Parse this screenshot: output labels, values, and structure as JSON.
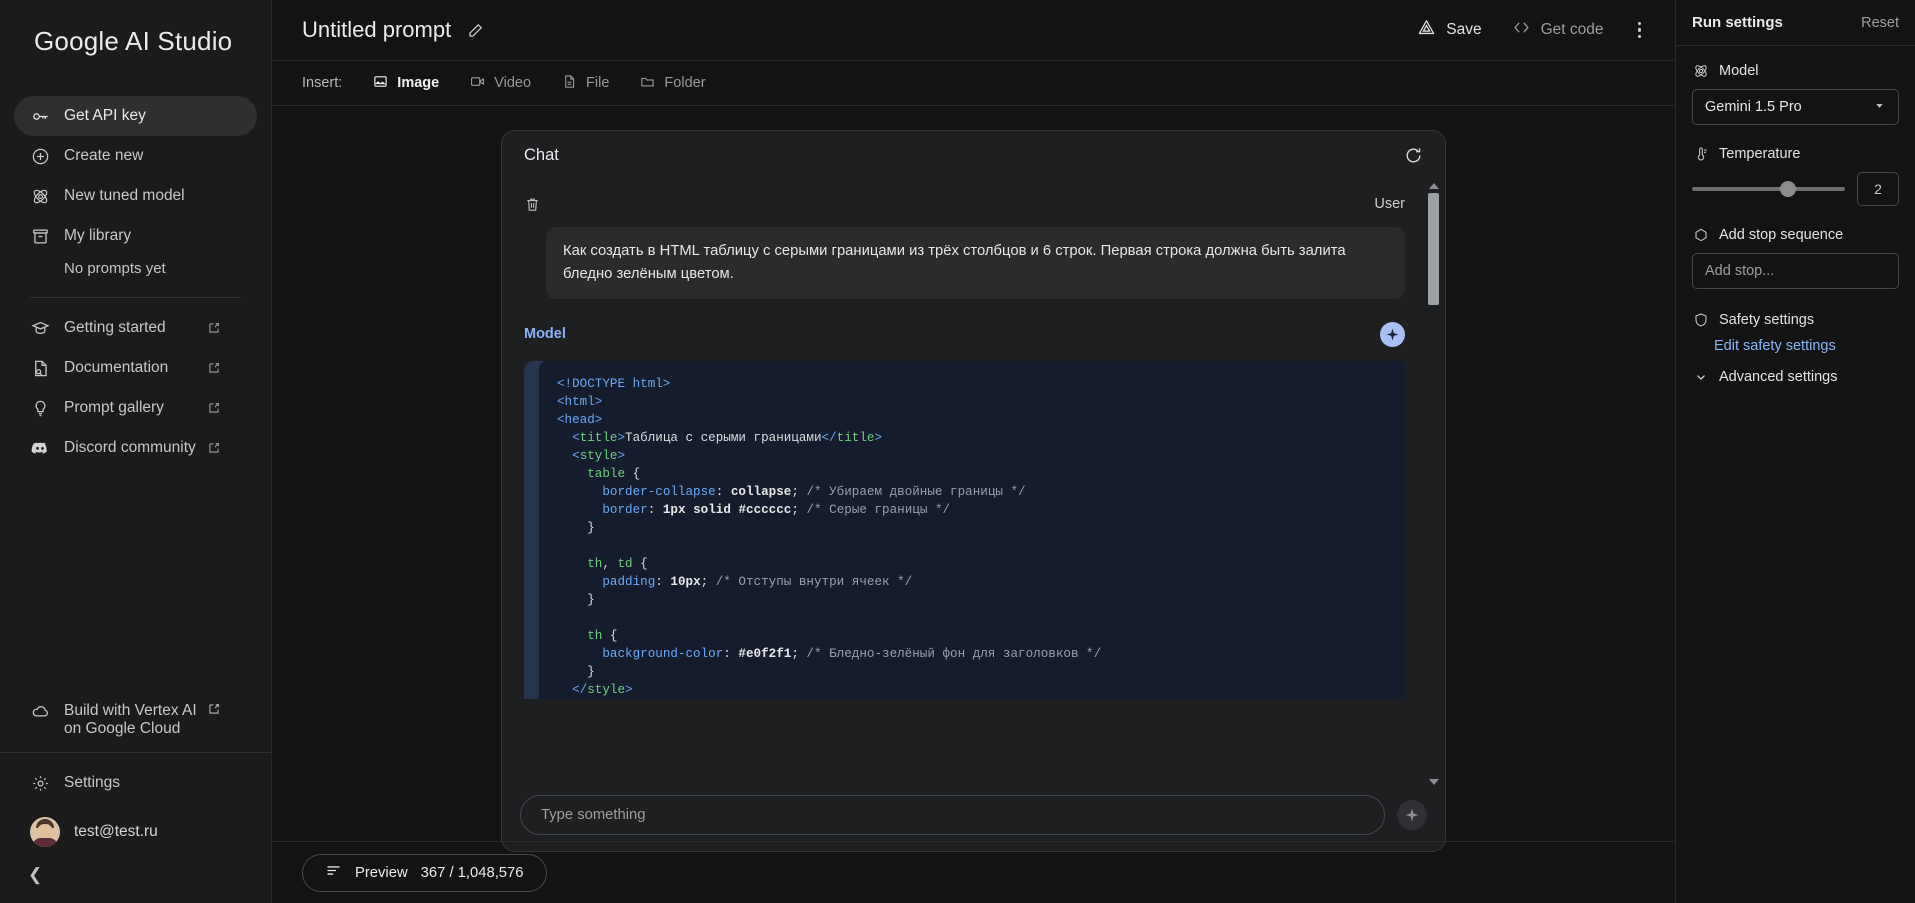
{
  "sidebar": {
    "brand": "Google AI Studio",
    "items": [
      {
        "label": "Get API key",
        "icon": "key-icon",
        "active": true,
        "external": false
      },
      {
        "label": "Create new",
        "icon": "plus-circle-icon",
        "active": false,
        "external": false
      },
      {
        "label": "New tuned model",
        "icon": "tuned-model-icon",
        "active": false,
        "external": false
      },
      {
        "label": "My library",
        "icon": "library-icon",
        "active": false,
        "external": false
      }
    ],
    "empty_note": "No prompts yet",
    "links": [
      {
        "label": "Getting started",
        "icon": "graduation-cap-icon",
        "external": true
      },
      {
        "label": "Documentation",
        "icon": "document-search-icon",
        "external": true
      },
      {
        "label": "Prompt gallery",
        "icon": "lightbulb-icon",
        "external": true
      },
      {
        "label": "Discord community",
        "icon": "discord-icon",
        "external": true
      }
    ],
    "vertex": {
      "label": "Build with Vertex AI on Google Cloud",
      "icon": "cloud-icon"
    },
    "settings": {
      "label": "Settings",
      "icon": "gear-icon"
    },
    "account": {
      "email": "test@test.ru"
    }
  },
  "header": {
    "prompt_title": "Untitled prompt",
    "edit_icon": "pencil-icon",
    "save_label": "Save",
    "save_icon": "save-drive-icon",
    "get_code_label": "Get code",
    "get_code_icon": "code-brackets-icon",
    "more_icon": "kebab-menu-icon"
  },
  "insert_bar": {
    "label": "Insert:",
    "items": [
      {
        "label": "Image",
        "icon": "image-icon",
        "selected": true
      },
      {
        "label": "Video",
        "icon": "video-icon",
        "selected": false
      },
      {
        "label": "File",
        "icon": "file-icon",
        "selected": false
      },
      {
        "label": "Folder",
        "icon": "folder-icon",
        "selected": false
      }
    ]
  },
  "chat": {
    "title": "Chat",
    "refresh_icon": "refresh-icon",
    "user_turn": {
      "role": "User",
      "delete_icon": "trash-icon",
      "text": "Как создать в HTML таблицу с серыми границами из трёх столбцов и 6 строк. Первая строка должна быть залита бледно зелёным цветом."
    },
    "model_turn": {
      "role": "Model",
      "sparkle_icon": "sparkle-icon",
      "code_lines": [
        [
          {
            "t": "tag",
            "s": "<!DOCTYPE html>"
          }
        ],
        [
          {
            "t": "tag",
            "s": "<html>"
          }
        ],
        [
          {
            "t": "tag",
            "s": "<head>"
          }
        ],
        [
          {
            "t": "plain",
            "s": "  "
          },
          {
            "t": "tag",
            "s": "<"
          },
          {
            "t": "tagname",
            "s": "title"
          },
          {
            "t": "tag",
            "s": ">"
          },
          {
            "t": "plain",
            "s": "Таблица с серыми границами"
          },
          {
            "t": "tag",
            "s": "</"
          },
          {
            "t": "tagname",
            "s": "title"
          },
          {
            "t": "tag",
            "s": ">"
          }
        ],
        [
          {
            "t": "plain",
            "s": "  "
          },
          {
            "t": "tag",
            "s": "<"
          },
          {
            "t": "tagname",
            "s": "style"
          },
          {
            "t": "tag",
            "s": ">"
          }
        ],
        [
          {
            "t": "plain",
            "s": "    "
          },
          {
            "t": "sel",
            "s": "table"
          },
          {
            "t": "punc",
            "s": " {"
          }
        ],
        [
          {
            "t": "plain",
            "s": "      "
          },
          {
            "t": "prop",
            "s": "border-collapse"
          },
          {
            "t": "punc",
            "s": ": "
          },
          {
            "t": "val",
            "s": "collapse"
          },
          {
            "t": "punc",
            "s": ";"
          },
          {
            "t": "cmt",
            "s": " /* Убираем двойные границы */"
          }
        ],
        [
          {
            "t": "plain",
            "s": "      "
          },
          {
            "t": "prop",
            "s": "border"
          },
          {
            "t": "punc",
            "s": ": "
          },
          {
            "t": "num",
            "s": "1px"
          },
          {
            "t": "punc",
            "s": " "
          },
          {
            "t": "val",
            "s": "solid"
          },
          {
            "t": "punc",
            "s": " "
          },
          {
            "t": "num",
            "s": "#cccccc"
          },
          {
            "t": "punc",
            "s": ";"
          },
          {
            "t": "cmt",
            "s": " /* Серые границы */"
          }
        ],
        [
          {
            "t": "plain",
            "s": "    "
          },
          {
            "t": "punc",
            "s": "}"
          }
        ],
        [
          {
            "t": "plain",
            "s": ""
          }
        ],
        [
          {
            "t": "plain",
            "s": "    "
          },
          {
            "t": "sel",
            "s": "th"
          },
          {
            "t": "punc",
            "s": ", "
          },
          {
            "t": "sel",
            "s": "td"
          },
          {
            "t": "punc",
            "s": " {"
          }
        ],
        [
          {
            "t": "plain",
            "s": "      "
          },
          {
            "t": "prop",
            "s": "padding"
          },
          {
            "t": "punc",
            "s": ": "
          },
          {
            "t": "num",
            "s": "10px"
          },
          {
            "t": "punc",
            "s": ";"
          },
          {
            "t": "cmt",
            "s": " /* Отступы внутри ячеек */"
          }
        ],
        [
          {
            "t": "plain",
            "s": "    "
          },
          {
            "t": "punc",
            "s": "}"
          }
        ],
        [
          {
            "t": "plain",
            "s": ""
          }
        ],
        [
          {
            "t": "plain",
            "s": "    "
          },
          {
            "t": "sel",
            "s": "th"
          },
          {
            "t": "punc",
            "s": " {"
          }
        ],
        [
          {
            "t": "plain",
            "s": "      "
          },
          {
            "t": "prop",
            "s": "background-color"
          },
          {
            "t": "punc",
            "s": ": "
          },
          {
            "t": "num",
            "s": "#e0f2f1"
          },
          {
            "t": "punc",
            "s": ";"
          },
          {
            "t": "cmt",
            "s": " /* Бледно-зелёный фон для заголовков */"
          }
        ],
        [
          {
            "t": "plain",
            "s": "    "
          },
          {
            "t": "punc",
            "s": "}"
          }
        ],
        [
          {
            "t": "plain",
            "s": "  "
          },
          {
            "t": "tag",
            "s": "</"
          },
          {
            "t": "tagname",
            "s": "style"
          },
          {
            "t": "tag",
            "s": ">"
          }
        ]
      ]
    },
    "input_placeholder": "Type something",
    "input_value": "",
    "send_icon": "sparkle-send-icon"
  },
  "bottom_bar": {
    "preview_label": "Preview",
    "preview_icon": "lines-icon",
    "token_count": "367 / 1,048,576"
  },
  "run_settings": {
    "title": "Run settings",
    "reset_label": "Reset",
    "model_label": "Model",
    "model_icon": "tuned-model-icon",
    "model_value": "Gemini 1.5 Pro",
    "temperature_label": "Temperature",
    "temperature_icon": "thermometer-icon",
    "temperature_value": "2",
    "stop_label": "Add stop sequence",
    "stop_icon": "hexagon-icon",
    "stop_placeholder": "Add stop...",
    "safety_label": "Safety settings",
    "safety_icon": "shield-icon",
    "safety_link": "Edit safety settings",
    "advanced_label": "Advanced settings",
    "advanced_icon": "chevron-down-icon"
  },
  "colors": {
    "accent_blue": "#8ab4f8",
    "code_bg": "#141c2e",
    "panel_bg": "#1e1f21"
  }
}
